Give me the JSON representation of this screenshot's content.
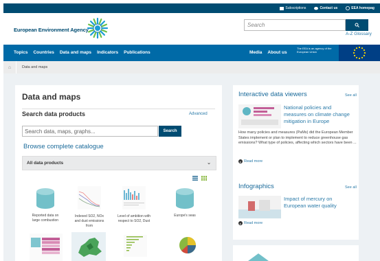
{
  "topbar": {
    "subscriptions": "Subscriptions",
    "contact": "Contact us",
    "homepage": "EEA homepag"
  },
  "header": {
    "agency_name": "European Environment Agency",
    "search_placeholder": "Search",
    "az_glossary": "A-Z Glossary"
  },
  "nav": {
    "items": [
      "Topics",
      "Countries",
      "Data and maps",
      "Indicators",
      "Publications"
    ],
    "right": [
      "Media",
      "About us"
    ],
    "eu_text": "The EEA is an agency of the European Union"
  },
  "breadcrumb": {
    "current": "Data and maps"
  },
  "left": {
    "title": "Data and maps",
    "search_title": "Search data products",
    "advanced": "Advanced",
    "search_placeholder": "Search data, maps, graphs...",
    "search_button": "Search",
    "browse": "Browse complete catalogue",
    "accordion": "All data products",
    "products": [
      {
        "label": "Reported data on large combustion"
      },
      {
        "label": "Indexed SO2, NOx and dust emissions from"
      },
      {
        "label": "Level of ambition with respect to SO2, Dust"
      },
      {
        "label": "Europe's seas"
      }
    ]
  },
  "right1": {
    "title": "Interactive data viewers",
    "see_all": "See all",
    "item_title": "National policies and measures on climate change mitigation in Europe",
    "description": "How many policies and measures (PaMs) did the European Member States implement or plan to implement to reduce greenhouse gas emissions? What type of policies, affecting which sectors have been ...",
    "read_more": "Read more"
  },
  "right2": {
    "title": "Infographics",
    "see_all": "See all",
    "item_title": "Impact of mercury on European water quality",
    "read_more": "Read more"
  },
  "colors": {
    "topbar": "#004c72",
    "nav": "#006aa7",
    "link": "#2a7aa8",
    "teal": "#6fb6c0"
  }
}
